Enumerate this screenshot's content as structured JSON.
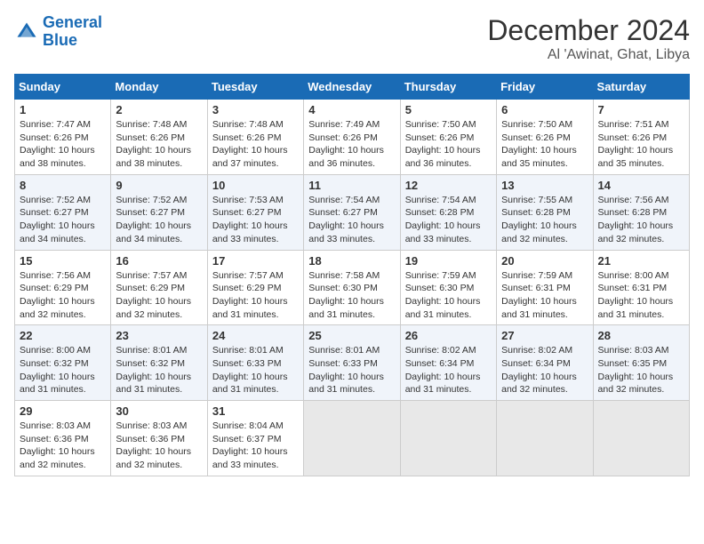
{
  "header": {
    "logo_line1": "General",
    "logo_line2": "Blue",
    "main_title": "December 2024",
    "subtitle": "Al 'Awinat, Ghat, Libya"
  },
  "days_of_week": [
    "Sunday",
    "Monday",
    "Tuesday",
    "Wednesday",
    "Thursday",
    "Friday",
    "Saturday"
  ],
  "weeks": [
    [
      {
        "day": 1,
        "rise": "7:47 AM",
        "set": "6:26 PM",
        "daylight": "10 hours and 38 minutes."
      },
      {
        "day": 2,
        "rise": "7:48 AM",
        "set": "6:26 PM",
        "daylight": "10 hours and 38 minutes."
      },
      {
        "day": 3,
        "rise": "7:48 AM",
        "set": "6:26 PM",
        "daylight": "10 hours and 37 minutes."
      },
      {
        "day": 4,
        "rise": "7:49 AM",
        "set": "6:26 PM",
        "daylight": "10 hours and 36 minutes."
      },
      {
        "day": 5,
        "rise": "7:50 AM",
        "set": "6:26 PM",
        "daylight": "10 hours and 36 minutes."
      },
      {
        "day": 6,
        "rise": "7:50 AM",
        "set": "6:26 PM",
        "daylight": "10 hours and 35 minutes."
      },
      {
        "day": 7,
        "rise": "7:51 AM",
        "set": "6:26 PM",
        "daylight": "10 hours and 35 minutes."
      }
    ],
    [
      {
        "day": 8,
        "rise": "7:52 AM",
        "set": "6:27 PM",
        "daylight": "10 hours and 34 minutes."
      },
      {
        "day": 9,
        "rise": "7:52 AM",
        "set": "6:27 PM",
        "daylight": "10 hours and 34 minutes."
      },
      {
        "day": 10,
        "rise": "7:53 AM",
        "set": "6:27 PM",
        "daylight": "10 hours and 33 minutes."
      },
      {
        "day": 11,
        "rise": "7:54 AM",
        "set": "6:27 PM",
        "daylight": "10 hours and 33 minutes."
      },
      {
        "day": 12,
        "rise": "7:54 AM",
        "set": "6:28 PM",
        "daylight": "10 hours and 33 minutes."
      },
      {
        "day": 13,
        "rise": "7:55 AM",
        "set": "6:28 PM",
        "daylight": "10 hours and 32 minutes."
      },
      {
        "day": 14,
        "rise": "7:56 AM",
        "set": "6:28 PM",
        "daylight": "10 hours and 32 minutes."
      }
    ],
    [
      {
        "day": 15,
        "rise": "7:56 AM",
        "set": "6:29 PM",
        "daylight": "10 hours and 32 minutes."
      },
      {
        "day": 16,
        "rise": "7:57 AM",
        "set": "6:29 PM",
        "daylight": "10 hours and 32 minutes."
      },
      {
        "day": 17,
        "rise": "7:57 AM",
        "set": "6:29 PM",
        "daylight": "10 hours and 31 minutes."
      },
      {
        "day": 18,
        "rise": "7:58 AM",
        "set": "6:30 PM",
        "daylight": "10 hours and 31 minutes."
      },
      {
        "day": 19,
        "rise": "7:59 AM",
        "set": "6:30 PM",
        "daylight": "10 hours and 31 minutes."
      },
      {
        "day": 20,
        "rise": "7:59 AM",
        "set": "6:31 PM",
        "daylight": "10 hours and 31 minutes."
      },
      {
        "day": 21,
        "rise": "8:00 AM",
        "set": "6:31 PM",
        "daylight": "10 hours and 31 minutes."
      }
    ],
    [
      {
        "day": 22,
        "rise": "8:00 AM",
        "set": "6:32 PM",
        "daylight": "10 hours and 31 minutes."
      },
      {
        "day": 23,
        "rise": "8:01 AM",
        "set": "6:32 PM",
        "daylight": "10 hours and 31 minutes."
      },
      {
        "day": 24,
        "rise": "8:01 AM",
        "set": "6:33 PM",
        "daylight": "10 hours and 31 minutes."
      },
      {
        "day": 25,
        "rise": "8:01 AM",
        "set": "6:33 PM",
        "daylight": "10 hours and 31 minutes."
      },
      {
        "day": 26,
        "rise": "8:02 AM",
        "set": "6:34 PM",
        "daylight": "10 hours and 31 minutes."
      },
      {
        "day": 27,
        "rise": "8:02 AM",
        "set": "6:34 PM",
        "daylight": "10 hours and 32 minutes."
      },
      {
        "day": 28,
        "rise": "8:03 AM",
        "set": "6:35 PM",
        "daylight": "10 hours and 32 minutes."
      }
    ],
    [
      {
        "day": 29,
        "rise": "8:03 AM",
        "set": "6:36 PM",
        "daylight": "10 hours and 32 minutes."
      },
      {
        "day": 30,
        "rise": "8:03 AM",
        "set": "6:36 PM",
        "daylight": "10 hours and 32 minutes."
      },
      {
        "day": 31,
        "rise": "8:04 AM",
        "set": "6:37 PM",
        "daylight": "10 hours and 33 minutes."
      },
      null,
      null,
      null,
      null
    ]
  ]
}
